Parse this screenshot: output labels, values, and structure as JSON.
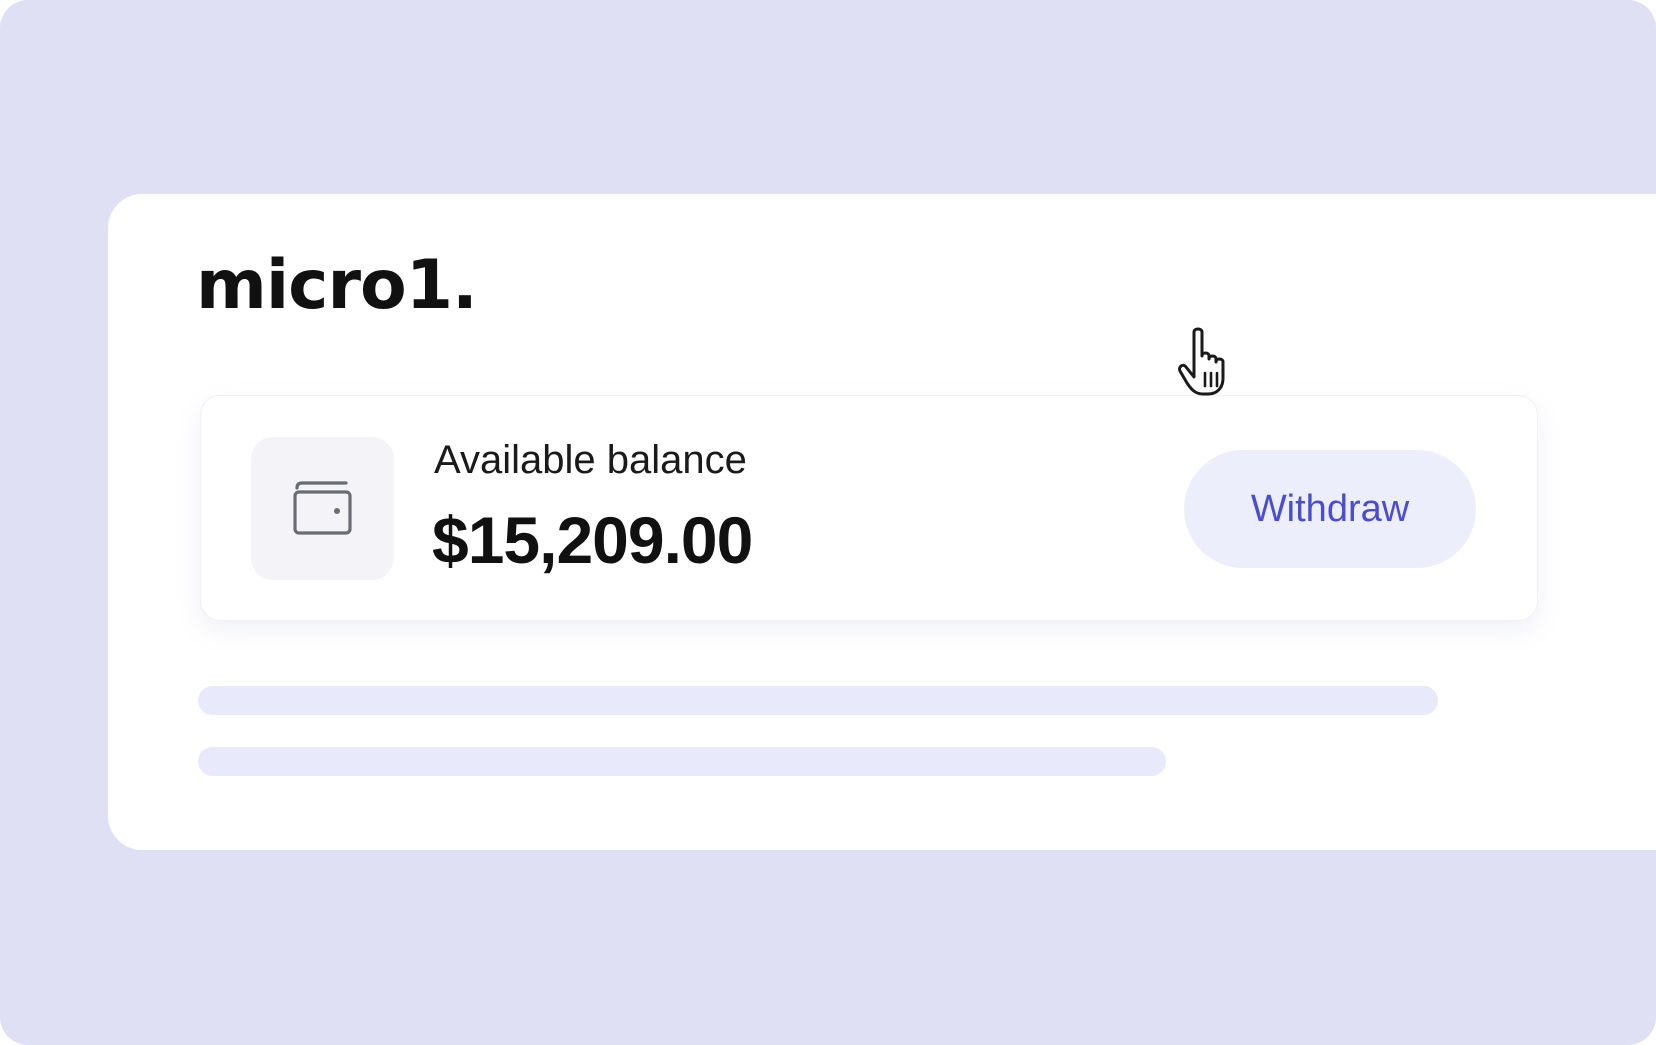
{
  "brand": {
    "logo_text": "micro1."
  },
  "balance": {
    "label": "Available balance",
    "amount": "$15,209.00",
    "icon": "wallet-icon"
  },
  "actions": {
    "withdraw_label": "Withdraw"
  },
  "cursor": {
    "icon": "hand-pointer-icon"
  },
  "colors": {
    "background": "#dfe0f3",
    "card": "#ffffff",
    "accent": "#4b4dcf",
    "button_bg": "#eceefb",
    "placeholder": "#e8e9fb"
  }
}
